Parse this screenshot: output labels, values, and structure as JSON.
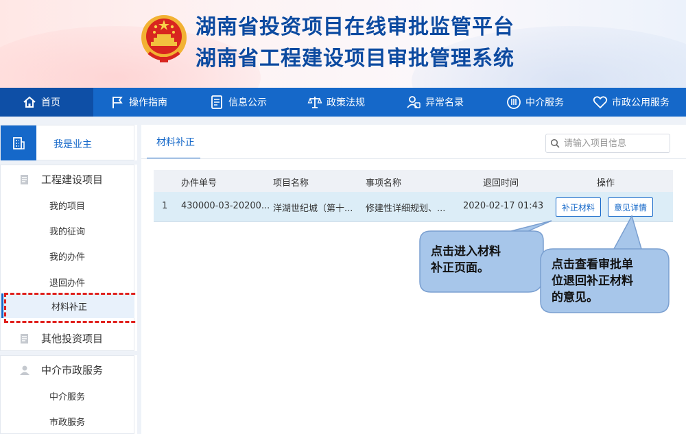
{
  "header": {
    "title_line1": "湖南省投资项目在线审批监管平台",
    "title_line2": "湖南省工程建设项目审批管理系统"
  },
  "nav": {
    "items": [
      {
        "label": "首页",
        "icon": "home-icon"
      },
      {
        "label": "操作指南",
        "icon": "flag-icon"
      },
      {
        "label": "信息公示",
        "icon": "document-icon"
      },
      {
        "label": "政策法规",
        "icon": "scale-icon"
      },
      {
        "label": "异常名录",
        "icon": "user-card-icon"
      },
      {
        "label": "中介服务",
        "icon": "service-icon"
      },
      {
        "label": "市政公用服务",
        "icon": "heart-icon"
      }
    ],
    "active_index": 0
  },
  "sidebar": {
    "role_label": "我是业主",
    "groups": [
      {
        "label": "工程建设项目",
        "items": [
          "我的项目",
          "我的征询",
          "我的办件",
          "退回办件",
          "材料补正"
        ]
      },
      {
        "label": "其他投资项目",
        "items": []
      },
      {
        "label": "中介市政服务",
        "items": [
          "中介服务",
          "市政服务"
        ]
      }
    ],
    "active_item": "材料补正"
  },
  "main": {
    "tab_label": "材料补正",
    "search_placeholder": "请输入项目信息",
    "table": {
      "headers": [
        "办件单号",
        "项目名称",
        "事项名称",
        "退回时间",
        "操作"
      ],
      "rows": [
        {
          "index": "1",
          "case_no": "430000-03-20200...",
          "project_name": "洋湖世纪城（第十...",
          "item_name": "修建性详细规划、...",
          "return_time": "2020-02-17 01:43",
          "actions": [
            "补正材料",
            "意见详情"
          ]
        }
      ]
    }
  },
  "callouts": {
    "left": [
      "点击进入材料",
      "补正页面。"
    ],
    "right": [
      "点击查看审批单",
      "位退回补正材料",
      "的意见。"
    ]
  },
  "colors": {
    "brand_blue": "#1568c9",
    "title_blue": "#0c4aa0",
    "callout_fill": "#a7c6ea",
    "highlight_red": "#e0201c"
  }
}
